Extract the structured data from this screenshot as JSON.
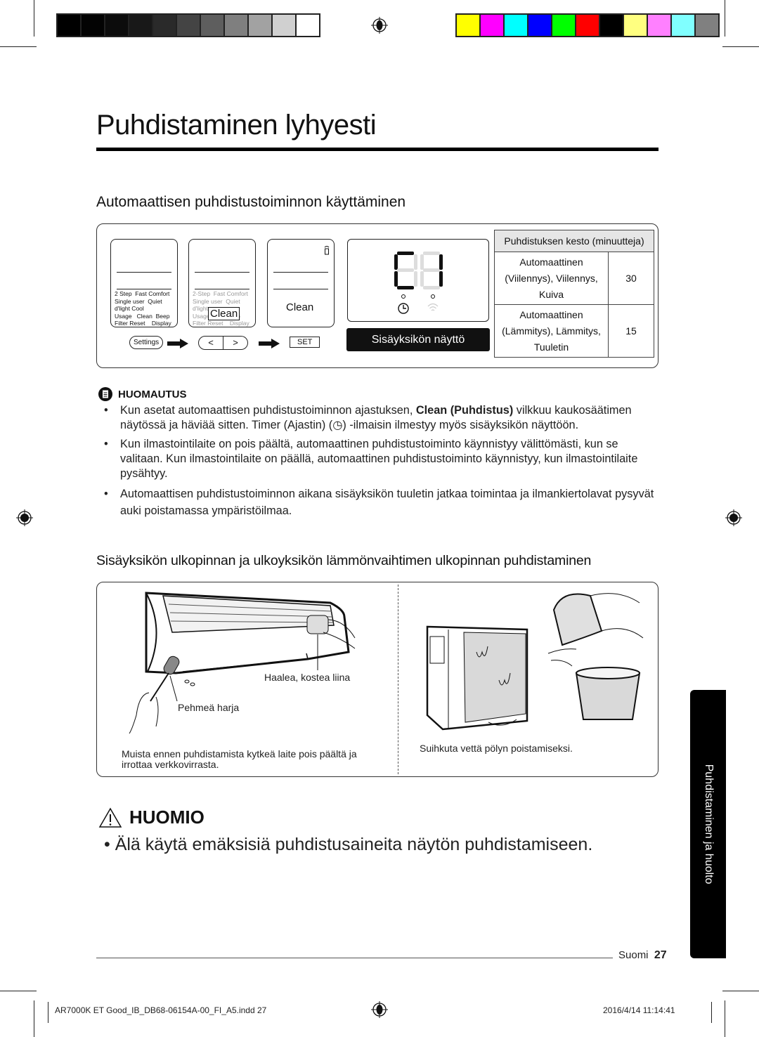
{
  "page": {
    "title": "Puhdistaminen lyhyesti",
    "section1_heading": "Automaattisen puhdistustoiminnon käyttäminen",
    "remote": {
      "lcd1_menu": "2 Step  Fast Comfort\nSingle user  Quiet\nd'light Cool\nUsage   Clean  Beep\nFilter Reset    Display",
      "lcd2_menu": "2-Step  Fast Comfort\nSingle user  Quiet\nd'light\nUsage          Beep\nFilter Reset    Display",
      "lcd2_highlight": "Clean",
      "lcd3_text": "Clean",
      "settings_button": "Settings",
      "left_button": "<",
      "right_button": ">",
      "set_button": "SET"
    },
    "indoor_display": {
      "segment_text": "C",
      "label": "Sisäyksikön näyttö"
    },
    "duration_table": {
      "header": "Puhdistuksen kesto (minuutteja)",
      "rows": [
        {
          "modes": "Automaattinen (Viilennys), Viilennys, Kuiva",
          "minutes": "30"
        },
        {
          "modes": "Automaattinen (Lämmitys), Lämmitys, Tuuletin",
          "minutes": "15"
        }
      ]
    },
    "note": {
      "heading": "HUOMAUTUS",
      "items": [
        {
          "pre": "Kun asetat automaattisen puhdistustoiminnon ajastuksen, ",
          "bold": "Clean (Puhdistus)",
          "post": " vilkkuu kaukosäätimen näytössä ja häviää sitten. Timer (Ajastin) (◷) -ilmaisin ilmestyy myös sisäyksikön näyttöön."
        },
        {
          "pre": "Kun ilmastointilaite on pois päältä, automaattinen puhdistustoiminto käynnistyy välittömästi, kun se valitaan. Kun ilmastointilaite on päällä, automaattinen puhdistustoiminto käynnistyy, kun ilmastointilaite pysähtyy.",
          "bold": "",
          "post": ""
        },
        {
          "pre": "Automaattisen puhdistustoiminnon aikana sisäyksikön tuuletin jatkaa toimintaa ja ilmankiertolavat pysyvät auki poistamassa ympäristöilmaa.",
          "bold": "",
          "post": ""
        }
      ]
    },
    "section2_heading": "Sisäyksikön ulkopinnan ja ulkoyksikön lämmönvaihtimen ulkopinnan puhdistaminen",
    "illustration": {
      "cloth_label": "Haalea, kostea liina",
      "brush_label": "Pehmeä harja",
      "left_caption": "Muista ennen puhdistamista kytkeä laite pois päältä ja irrottaa verkkovirrasta.",
      "right_caption": "Suihkuta vettä pölyn poistamiseksi."
    },
    "caution": {
      "heading": "HUOMIO",
      "text": "Älä käytä emäksisiä puhdistusaineita näytön puhdistamiseen."
    },
    "side_tab": "Puhdistaminen ja huolto",
    "footer": {
      "language": "Suomi",
      "page_number": "27",
      "slug_file": "AR7000K ET Good_IB_DB68-06154A-00_FI_A5.indd   27",
      "slug_date": "2016/4/14   11:14:41"
    }
  },
  "print_marks": {
    "gray_bar": [
      "#000000",
      "#030303",
      "#0c0c0c",
      "#181818",
      "#2a2a2a",
      "#444444",
      "#5e5e5e",
      "#7f7f7f",
      "#a2a2a2",
      "#d0d0d0",
      "#ffffff"
    ],
    "color_bar": [
      "#ffff00",
      "#ff00ff",
      "#00ffff",
      "#0000ff",
      "#00ff00",
      "#ff0000",
      "#000000",
      "#ffff80",
      "#ff80ff",
      "#80ffff",
      "#808080"
    ]
  }
}
